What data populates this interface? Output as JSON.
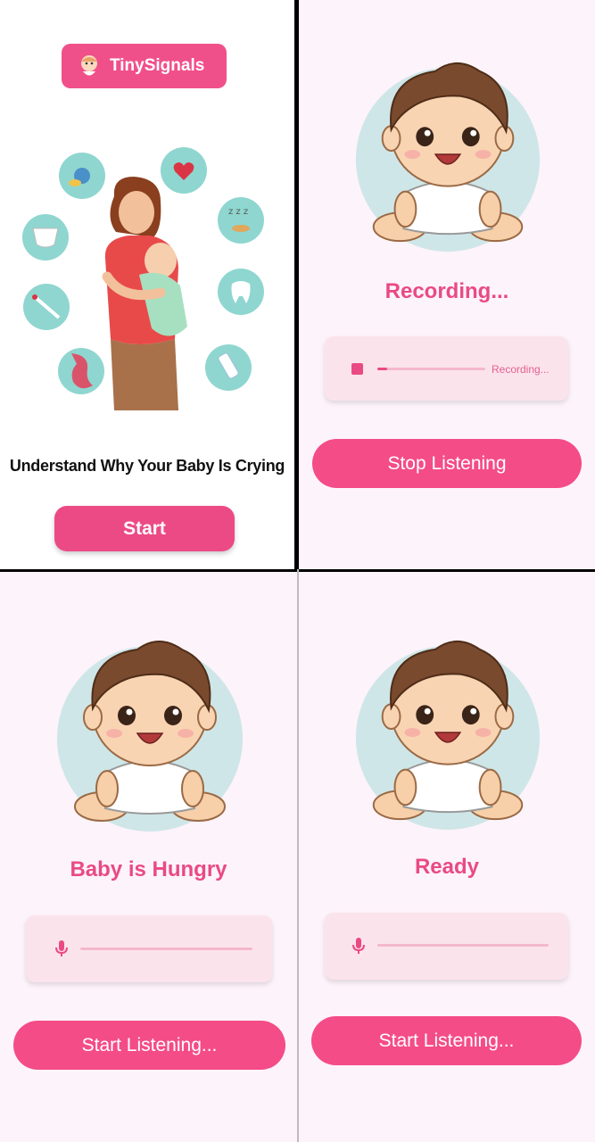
{
  "colors": {
    "accent": "#f44c86",
    "card": "#fbe3ec",
    "background": "#fdf3fa"
  },
  "welcome": {
    "logo_text": "TinySignals",
    "tagline": "Understand Why Your Baby Is Crying",
    "start_label": "Start",
    "icons": [
      "pacifier-icon",
      "heart-icon",
      "diaper-icon",
      "sleep-icon",
      "thermometer-icon",
      "tooth-icon",
      "stomach-icon",
      "bottle-icon"
    ]
  },
  "recording": {
    "status": "Recording...",
    "progress": 0.09,
    "progress_label": "Recording...",
    "button": "Stop Listening"
  },
  "result": {
    "status": "Baby is Hungry",
    "button": "Start Listening..."
  },
  "ready": {
    "status": "Ready",
    "button": "Start Listening..."
  }
}
